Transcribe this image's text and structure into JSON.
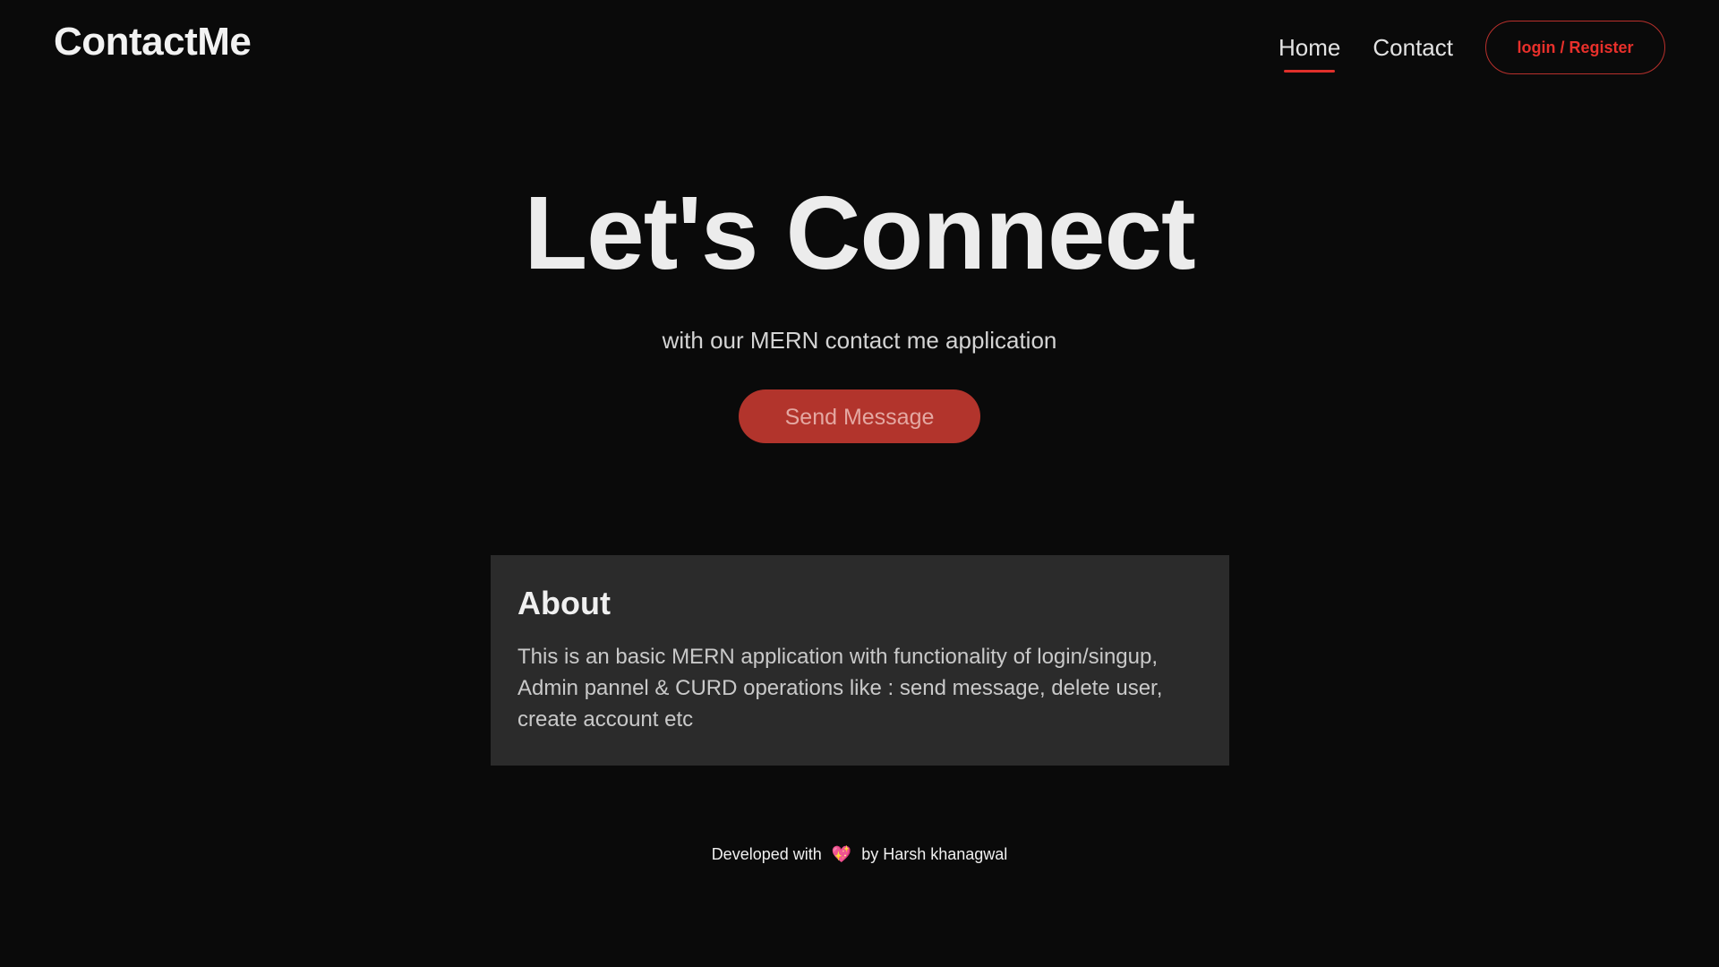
{
  "navbar": {
    "logo": "ContactMe",
    "links": [
      {
        "label": "Home"
      },
      {
        "label": "Contact"
      }
    ],
    "auth_button": "login / Register"
  },
  "hero": {
    "title": "Let's Connect",
    "subtitle": "with our MERN contact me application",
    "cta_label": "Send Message"
  },
  "about": {
    "title": "About",
    "text": "This is an basic MERN application with functionality of login/singup, Admin pannel & CURD operations like : send message, delete user, create account etc"
  },
  "footer": {
    "prefix": "Developed with",
    "heart": "💖",
    "suffix": "by Harsh khanagwal"
  },
  "colors": {
    "background": "#0a0a0a",
    "accent": "#e0302b",
    "button_bg": "#b2342c",
    "card_bg": "#2b2b2b"
  }
}
